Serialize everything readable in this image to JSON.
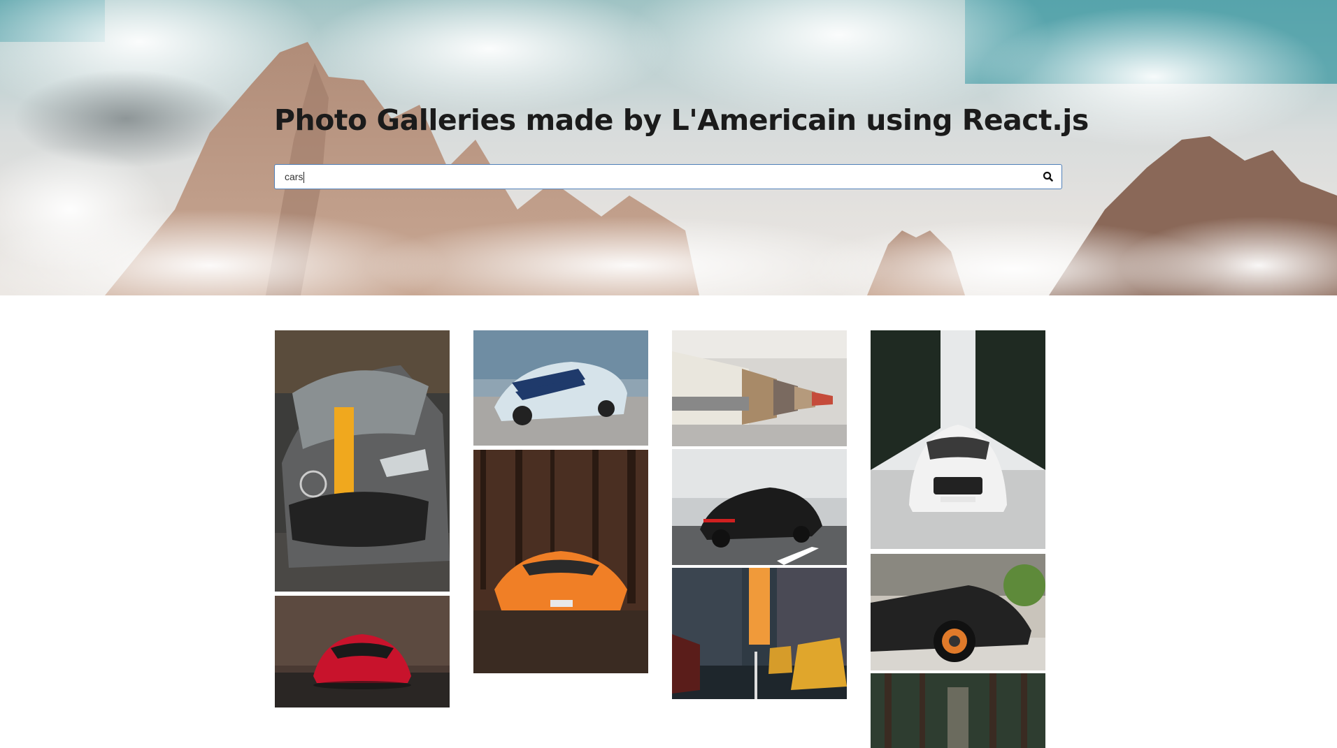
{
  "header": {
    "title": "Photo Galleries made by L'Americain using React.js"
  },
  "search": {
    "value": "cars",
    "placeholder": "",
    "button_icon": "search-icon"
  },
  "colors": {
    "search_border": "#4f7fb8",
    "title": "#1b1b1b",
    "background": "#ffffff"
  },
  "gallery": {
    "query": "cars",
    "photos": [
      {
        "subject": "grey-mercedes-amg-yellow-stripe"
      },
      {
        "subject": "red-ferrari-front"
      },
      {
        "subject": "white-mustang-blue-stripes"
      },
      {
        "subject": "orange-lamborghini-forest"
      },
      {
        "subject": "vintage-bmw-row-garage"
      },
      {
        "subject": "black-porsche-panamera-road"
      },
      {
        "subject": "city-street-sunset-taxis"
      },
      {
        "subject": "white-audi-snow-forest"
      },
      {
        "subject": "black-lamborghini-side"
      },
      {
        "subject": "forest-road-dark"
      }
    ]
  }
}
